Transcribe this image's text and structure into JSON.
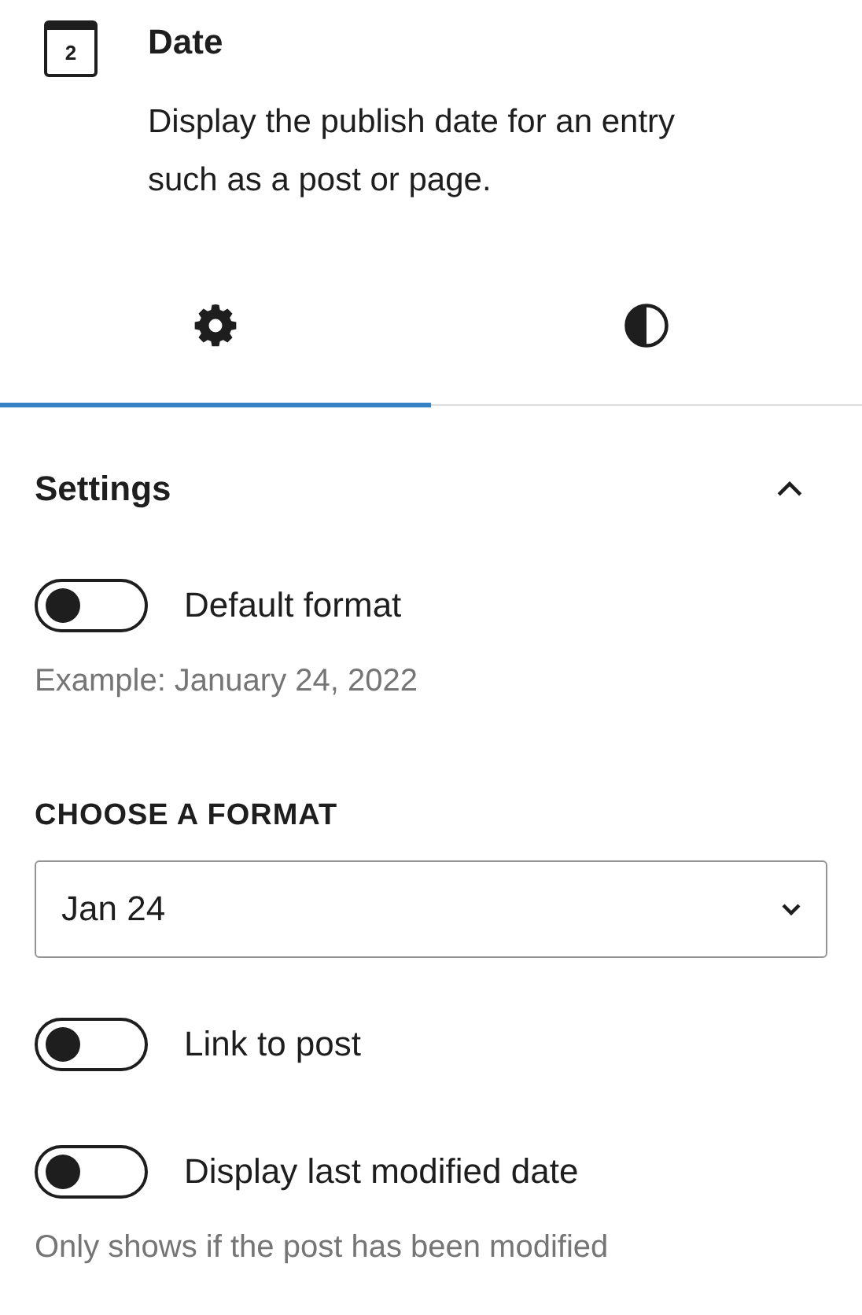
{
  "block": {
    "icon_text": "2",
    "title": "Date",
    "description": "Display the publish date for an entry such as a post or page."
  },
  "tabs": [
    {
      "kind": "settings",
      "selected": true
    },
    {
      "kind": "styles",
      "selected": false
    }
  ],
  "panel": {
    "title": "Settings",
    "expanded": true,
    "controls": [
      {
        "kind": "toggle",
        "label": "Default format",
        "on": false,
        "help": "Example: January 24, 2022"
      },
      {
        "kind": "select",
        "label": "CHOOSE A FORMAT",
        "value": "Jan 24"
      },
      {
        "kind": "toggle",
        "label": "Link to post",
        "on": false
      },
      {
        "kind": "toggle",
        "label": "Display last modified date",
        "on": false,
        "help": "Only shows if the post has been modified"
      }
    ]
  }
}
